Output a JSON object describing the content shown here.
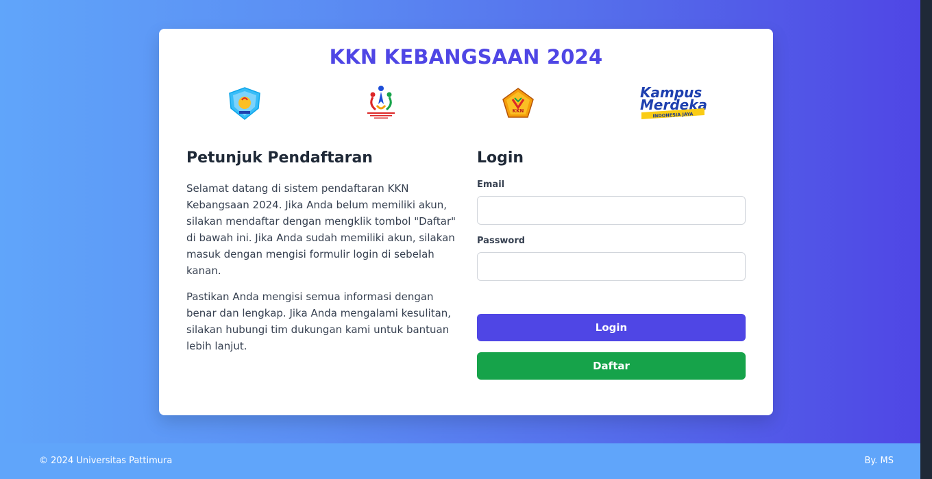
{
  "header": {
    "title": "KKN KEBANGSAAN 2024"
  },
  "logos": [
    {
      "name": "university-emblem",
      "color": "#38bdf8"
    },
    {
      "name": "kkn-kebangsaan-figures-logo",
      "color": "#2563eb"
    },
    {
      "name": "kkn-pentagon-badge",
      "color": "#f59e0b",
      "text": "KKN"
    },
    {
      "name": "kampus-merdeka-logo",
      "text_line1": "Kampus",
      "text_line2": "Merdeka",
      "tagline": "INDONESIA JAYA"
    }
  ],
  "instructions": {
    "heading": "Petunjuk Pendaftaran",
    "paragraph1": "Selamat datang di sistem pendaftaran KKN Kebangsaan 2024. Jika Anda belum memiliki akun, silakan mendaftar dengan mengklik tombol \"Daftar\" di bawah ini. Jika Anda sudah memiliki akun, silakan masuk dengan mengisi formulir login di sebelah kanan.",
    "paragraph2": "Pastikan Anda mengisi semua informasi dengan benar dan lengkap. Jika Anda mengalami kesulitan, silakan hubungi tim dukungan kami untuk bantuan lebih lanjut."
  },
  "login": {
    "heading": "Login",
    "email_label": "Email",
    "email_value": "",
    "password_label": "Password",
    "password_value": "",
    "login_button": "Login",
    "register_button": "Daftar"
  },
  "footer": {
    "copyright": "© 2024 Universitas Pattimura",
    "credit": "By. MS"
  },
  "colors": {
    "accent": "#4f46e5",
    "success": "#16a34a",
    "footer_bg": "#60a5fa"
  }
}
